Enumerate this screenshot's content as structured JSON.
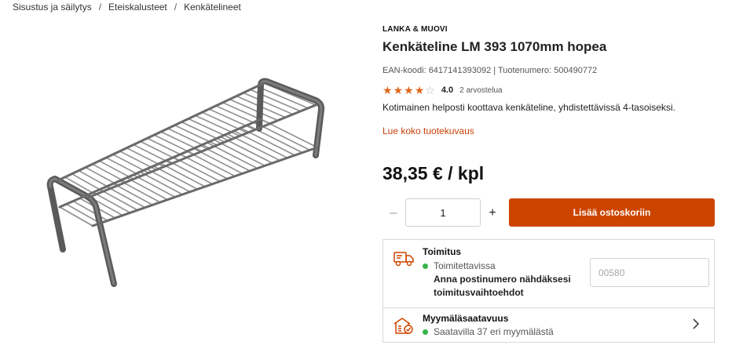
{
  "breadcrumb": {
    "items": [
      "Sisustus ja säilytys",
      "Eteiskalusteet",
      "Kenkätelineet"
    ],
    "separator": "/"
  },
  "product": {
    "brand": "LANKA & MUOVI",
    "title": "Kenkäteline LM 393 1070mm hopea",
    "codes": "EAN-koodi: 6417141393092 | Tuotenumero: 500490772",
    "rating": {
      "stars_filled": 4,
      "stars_total": 5,
      "value": "4.0",
      "count_label": "2 arvostelua"
    },
    "description": "Kotimainen helposti koottava kenkäteline, yhdistettävissä 4-tasoiseksi.",
    "read_more": "Lue koko tuotekuvaus",
    "price": "38,35 € / kpl",
    "image_icon": "shoe-rack-image"
  },
  "purchase": {
    "minus": "–",
    "quantity": "1",
    "plus": "+",
    "add_to_cart": "Lisää ostoskoriin"
  },
  "delivery": {
    "icon": "truck-icon",
    "title": "Toimitus",
    "status": "Toimitettavissa",
    "note": "Anna postinumero nähdäksesi toimitusvaihtoehdot",
    "postal_placeholder": "00580"
  },
  "store": {
    "icon": "store-icon",
    "title": "Myymäläsaatavuus",
    "status": "Saatavilla 37 eri myymälästä"
  },
  "colors": {
    "accent": "#cc4500",
    "link": "#c8410a",
    "star": "#e0671c",
    "available": "#38b54a"
  }
}
